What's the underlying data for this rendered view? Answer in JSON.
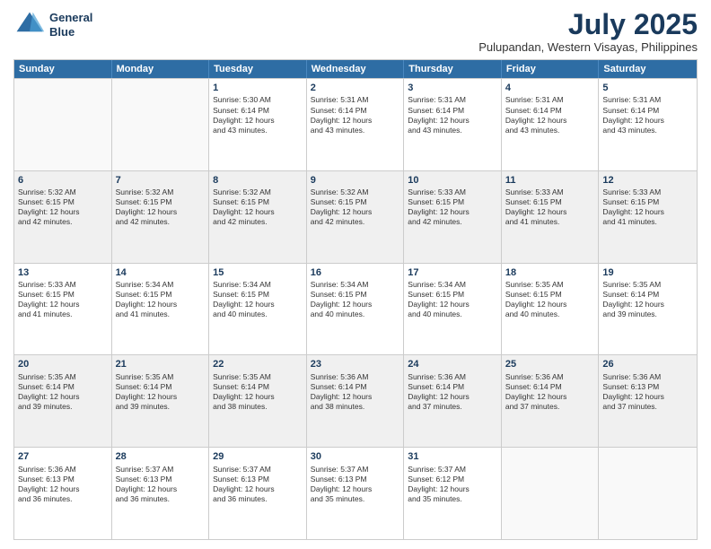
{
  "header": {
    "logo_line1": "General",
    "logo_line2": "Blue",
    "title": "July 2025",
    "subtitle": "Pulupandan, Western Visayas, Philippines"
  },
  "days_of_week": [
    "Sunday",
    "Monday",
    "Tuesday",
    "Wednesday",
    "Thursday",
    "Friday",
    "Saturday"
  ],
  "weeks": [
    [
      {
        "day": "",
        "empty": true
      },
      {
        "day": "",
        "empty": true
      },
      {
        "day": "1",
        "lines": [
          "Sunrise: 5:30 AM",
          "Sunset: 6:14 PM",
          "Daylight: 12 hours",
          "and 43 minutes."
        ]
      },
      {
        "day": "2",
        "lines": [
          "Sunrise: 5:31 AM",
          "Sunset: 6:14 PM",
          "Daylight: 12 hours",
          "and 43 minutes."
        ]
      },
      {
        "day": "3",
        "lines": [
          "Sunrise: 5:31 AM",
          "Sunset: 6:14 PM",
          "Daylight: 12 hours",
          "and 43 minutes."
        ]
      },
      {
        "day": "4",
        "lines": [
          "Sunrise: 5:31 AM",
          "Sunset: 6:14 PM",
          "Daylight: 12 hours",
          "and 43 minutes."
        ]
      },
      {
        "day": "5",
        "lines": [
          "Sunrise: 5:31 AM",
          "Sunset: 6:14 PM",
          "Daylight: 12 hours",
          "and 43 minutes."
        ]
      }
    ],
    [
      {
        "day": "6",
        "lines": [
          "Sunrise: 5:32 AM",
          "Sunset: 6:15 PM",
          "Daylight: 12 hours",
          "and 42 minutes."
        ]
      },
      {
        "day": "7",
        "lines": [
          "Sunrise: 5:32 AM",
          "Sunset: 6:15 PM",
          "Daylight: 12 hours",
          "and 42 minutes."
        ]
      },
      {
        "day": "8",
        "lines": [
          "Sunrise: 5:32 AM",
          "Sunset: 6:15 PM",
          "Daylight: 12 hours",
          "and 42 minutes."
        ]
      },
      {
        "day": "9",
        "lines": [
          "Sunrise: 5:32 AM",
          "Sunset: 6:15 PM",
          "Daylight: 12 hours",
          "and 42 minutes."
        ]
      },
      {
        "day": "10",
        "lines": [
          "Sunrise: 5:33 AM",
          "Sunset: 6:15 PM",
          "Daylight: 12 hours",
          "and 42 minutes."
        ]
      },
      {
        "day": "11",
        "lines": [
          "Sunrise: 5:33 AM",
          "Sunset: 6:15 PM",
          "Daylight: 12 hours",
          "and 41 minutes."
        ]
      },
      {
        "day": "12",
        "lines": [
          "Sunrise: 5:33 AM",
          "Sunset: 6:15 PM",
          "Daylight: 12 hours",
          "and 41 minutes."
        ]
      }
    ],
    [
      {
        "day": "13",
        "lines": [
          "Sunrise: 5:33 AM",
          "Sunset: 6:15 PM",
          "Daylight: 12 hours",
          "and 41 minutes."
        ]
      },
      {
        "day": "14",
        "lines": [
          "Sunrise: 5:34 AM",
          "Sunset: 6:15 PM",
          "Daylight: 12 hours",
          "and 41 minutes."
        ]
      },
      {
        "day": "15",
        "lines": [
          "Sunrise: 5:34 AM",
          "Sunset: 6:15 PM",
          "Daylight: 12 hours",
          "and 40 minutes."
        ]
      },
      {
        "day": "16",
        "lines": [
          "Sunrise: 5:34 AM",
          "Sunset: 6:15 PM",
          "Daylight: 12 hours",
          "and 40 minutes."
        ]
      },
      {
        "day": "17",
        "lines": [
          "Sunrise: 5:34 AM",
          "Sunset: 6:15 PM",
          "Daylight: 12 hours",
          "and 40 minutes."
        ]
      },
      {
        "day": "18",
        "lines": [
          "Sunrise: 5:35 AM",
          "Sunset: 6:15 PM",
          "Daylight: 12 hours",
          "and 40 minutes."
        ]
      },
      {
        "day": "19",
        "lines": [
          "Sunrise: 5:35 AM",
          "Sunset: 6:14 PM",
          "Daylight: 12 hours",
          "and 39 minutes."
        ]
      }
    ],
    [
      {
        "day": "20",
        "lines": [
          "Sunrise: 5:35 AM",
          "Sunset: 6:14 PM",
          "Daylight: 12 hours",
          "and 39 minutes."
        ]
      },
      {
        "day": "21",
        "lines": [
          "Sunrise: 5:35 AM",
          "Sunset: 6:14 PM",
          "Daylight: 12 hours",
          "and 39 minutes."
        ]
      },
      {
        "day": "22",
        "lines": [
          "Sunrise: 5:35 AM",
          "Sunset: 6:14 PM",
          "Daylight: 12 hours",
          "and 38 minutes."
        ]
      },
      {
        "day": "23",
        "lines": [
          "Sunrise: 5:36 AM",
          "Sunset: 6:14 PM",
          "Daylight: 12 hours",
          "and 38 minutes."
        ]
      },
      {
        "day": "24",
        "lines": [
          "Sunrise: 5:36 AM",
          "Sunset: 6:14 PM",
          "Daylight: 12 hours",
          "and 37 minutes."
        ]
      },
      {
        "day": "25",
        "lines": [
          "Sunrise: 5:36 AM",
          "Sunset: 6:14 PM",
          "Daylight: 12 hours",
          "and 37 minutes."
        ]
      },
      {
        "day": "26",
        "lines": [
          "Sunrise: 5:36 AM",
          "Sunset: 6:13 PM",
          "Daylight: 12 hours",
          "and 37 minutes."
        ]
      }
    ],
    [
      {
        "day": "27",
        "lines": [
          "Sunrise: 5:36 AM",
          "Sunset: 6:13 PM",
          "Daylight: 12 hours",
          "and 36 minutes."
        ]
      },
      {
        "day": "28",
        "lines": [
          "Sunrise: 5:37 AM",
          "Sunset: 6:13 PM",
          "Daylight: 12 hours",
          "and 36 minutes."
        ]
      },
      {
        "day": "29",
        "lines": [
          "Sunrise: 5:37 AM",
          "Sunset: 6:13 PM",
          "Daylight: 12 hours",
          "and 36 minutes."
        ]
      },
      {
        "day": "30",
        "lines": [
          "Sunrise: 5:37 AM",
          "Sunset: 6:13 PM",
          "Daylight: 12 hours",
          "and 35 minutes."
        ]
      },
      {
        "day": "31",
        "lines": [
          "Sunrise: 5:37 AM",
          "Sunset: 6:12 PM",
          "Daylight: 12 hours",
          "and 35 minutes."
        ]
      },
      {
        "day": "",
        "empty": true
      },
      {
        "day": "",
        "empty": true
      }
    ]
  ]
}
